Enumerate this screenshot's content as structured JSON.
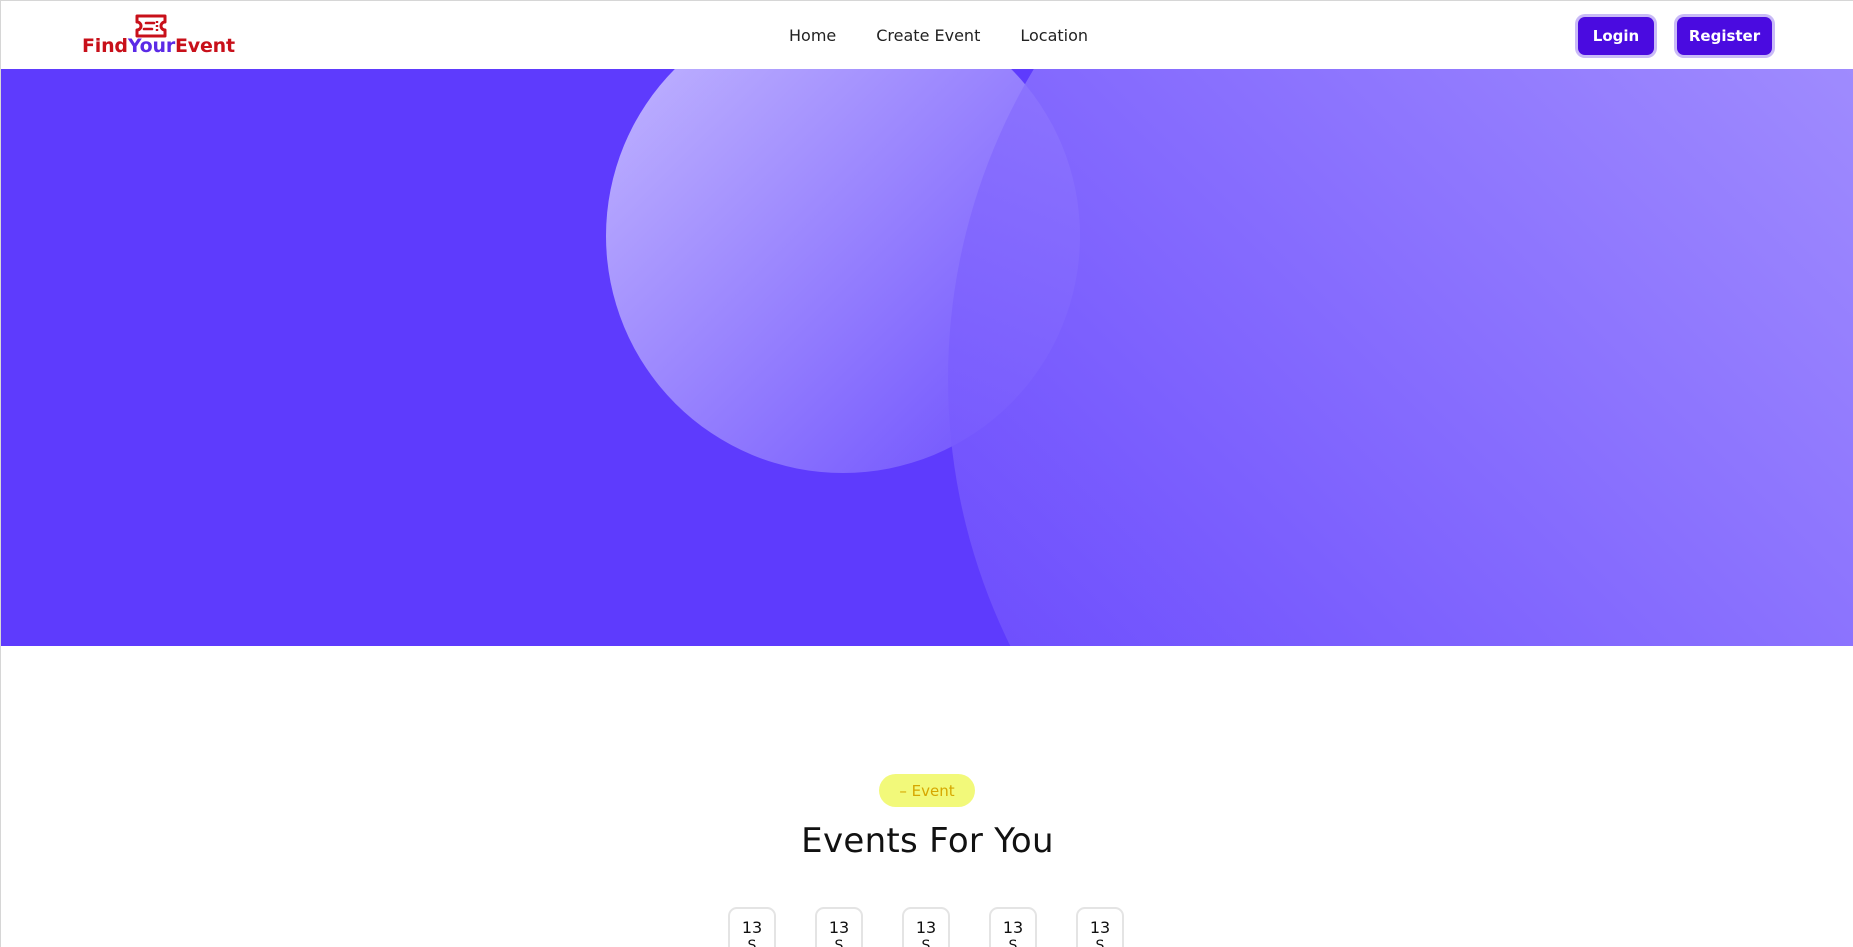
{
  "brand": {
    "part1": "Find",
    "part2": "Your",
    "part3": "Event",
    "icon": "ticket-icon",
    "colors": {
      "primary": "#c8101a",
      "secondary": "#5b2ae6"
    }
  },
  "nav": {
    "items": [
      {
        "label": "Home"
      },
      {
        "label": "Create Event"
      },
      {
        "label": "Location"
      }
    ]
  },
  "auth": {
    "login_label": "Login",
    "register_label": "Register"
  },
  "hero": {
    "background_color": "#5e3bfd",
    "accent_color": "#c0b3ff"
  },
  "events": {
    "badge": "– Event",
    "title": "Events For You",
    "dates": [
      {
        "day": "13",
        "month": "S"
      },
      {
        "day": "13",
        "month": "S"
      },
      {
        "day": "13",
        "month": "S"
      },
      {
        "day": "13",
        "month": "S"
      },
      {
        "day": "13",
        "month": "S"
      }
    ]
  },
  "colors": {
    "button": "#4a0be0",
    "badge_bg": "#f2f97a",
    "badge_text": "#d6a700"
  }
}
